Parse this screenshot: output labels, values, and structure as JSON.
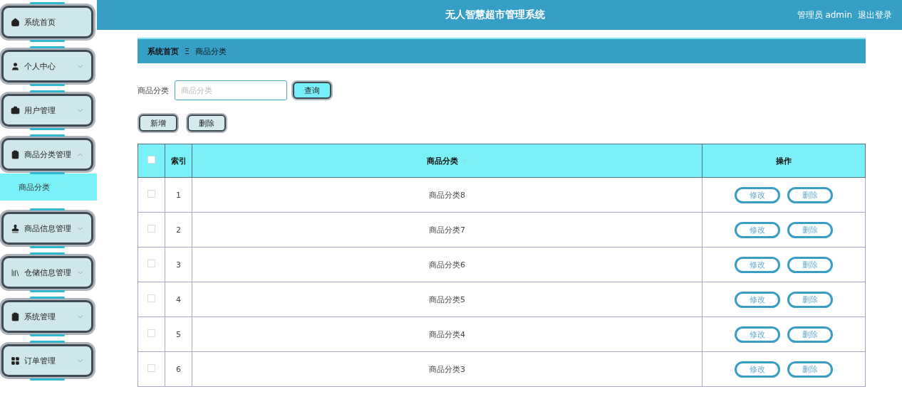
{
  "header": {
    "title": "无人智慧超市管理系统",
    "user": "管理员 admin",
    "logout": "退出登录"
  },
  "sidebar": {
    "items": [
      {
        "label": "系统首页",
        "kind": "link"
      },
      {
        "label": "个人中心",
        "kind": "menu",
        "expanded": false
      },
      {
        "label": "用户管理",
        "kind": "menu",
        "expanded": false
      },
      {
        "label": "商品分类管理",
        "kind": "menu",
        "expanded": true,
        "children": [
          {
            "label": "商品分类",
            "selected": true
          }
        ]
      },
      {
        "label": "商品信息管理",
        "kind": "menu",
        "expanded": false
      },
      {
        "label": "仓储信息管理",
        "kind": "menu",
        "expanded": false
      },
      {
        "label": "系统管理",
        "kind": "menu",
        "expanded": false
      },
      {
        "label": "订单管理",
        "kind": "menu",
        "expanded": false
      }
    ]
  },
  "breadcrumb": {
    "home": "系统首页",
    "separator": "Ξ",
    "current": "商品分类"
  },
  "search": {
    "label": "商品分类",
    "placeholder": "商品分类",
    "button": "查询"
  },
  "actions": [
    "新增",
    "删除"
  ],
  "table": {
    "columns": [
      {
        "label": "索引",
        "sortable": false
      },
      {
        "label": "商品分类",
        "sortable": true
      },
      {
        "label": "操作",
        "sortable": false
      }
    ],
    "all_checked": false,
    "rows": [
      {
        "index": "1",
        "name": "商品分类8",
        "checked": false,
        "buttons": [
          "修改",
          "删除"
        ]
      },
      {
        "index": "2",
        "name": "商品分类7",
        "checked": false,
        "buttons": [
          "修改",
          "删除"
        ]
      },
      {
        "index": "3",
        "name": "商品分类6",
        "checked": false,
        "buttons": [
          "修改",
          "删除"
        ]
      },
      {
        "index": "4",
        "name": "商品分类5",
        "checked": false,
        "buttons": [
          "修改",
          "删除"
        ]
      },
      {
        "index": "5",
        "name": "商品分类4",
        "checked": false,
        "buttons": [
          "修改",
          "删除"
        ]
      },
      {
        "index": "6",
        "name": "商品分类3",
        "checked": false,
        "buttons": [
          "修改",
          "删除"
        ]
      }
    ]
  }
}
